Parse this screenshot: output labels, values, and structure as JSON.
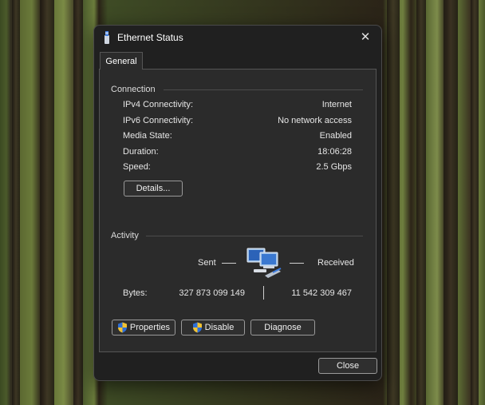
{
  "window": {
    "title": "Ethernet Status",
    "tab": "General"
  },
  "connection": {
    "group_label": "Connection",
    "rows": [
      {
        "label": "IPv4 Connectivity:",
        "value": "Internet"
      },
      {
        "label": "IPv6 Connectivity:",
        "value": "No network access"
      },
      {
        "label": "Media State:",
        "value": "Enabled"
      },
      {
        "label": "Duration:",
        "value": "18:06:28"
      },
      {
        "label": "Speed:",
        "value": "2.5 Gbps"
      }
    ],
    "details_button": "Details..."
  },
  "activity": {
    "group_label": "Activity",
    "sent_label": "Sent",
    "received_label": "Received",
    "bytes_label": "Bytes:",
    "bytes_sent": "327 873 099 149",
    "bytes_received": "11 542 309 467"
  },
  "buttons": {
    "properties": "Properties",
    "disable": "Disable",
    "diagnose": "Diagnose",
    "close": "Close"
  },
  "icons": {
    "title": "ethernet-icon",
    "activity": "network-computers-icon",
    "uac": "uac-shield-icon",
    "close": "close-icon"
  },
  "colors": {
    "dialog_bg": "#202020",
    "panel_bg": "#2b2b2b",
    "text": "#e6e6e6",
    "shield_blue": "#2f6fd6",
    "shield_yellow": "#f2c230"
  }
}
